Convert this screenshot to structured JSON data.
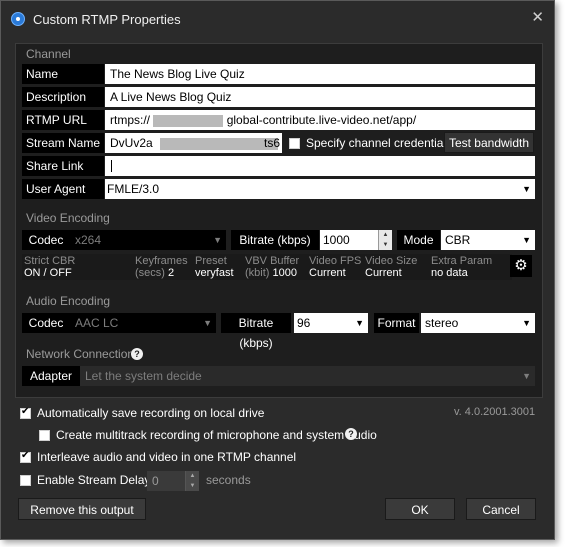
{
  "window": {
    "title": "Custom RTMP Properties",
    "close_glyph": "✕"
  },
  "channel": {
    "section": "Channel",
    "name_label": "Name",
    "name_value": "The News Blog Live Quiz",
    "desc_label": "Description",
    "desc_value": "A Live News Blog Quiz",
    "url_label": "RTMP URL",
    "url_prefix": "rtmps://",
    "url_suffix": "global-contribute.live-video.net/app/",
    "stream_label": "Stream Name",
    "stream_prefix": "DvUv2a",
    "stream_suffix": "ts6",
    "cred_label": "Specify channel credentials",
    "test_button": "Test bandwidth",
    "share_label": "Share Link",
    "share_value": "",
    "agent_label": "User Agent",
    "agent_value": "FMLE/3.0"
  },
  "video": {
    "section": "Video Encoding",
    "codec_label": "Codec",
    "codec_value": "x264",
    "bitrate_label": "Bitrate (kbps)",
    "bitrate_value": "1000",
    "mode_label": "Mode",
    "mode_value": "CBR",
    "stats": [
      {
        "k": "Strict CBR",
        "v": "ON / OFF"
      },
      {
        "k": "Keyframes",
        "k2": "(secs)",
        "v": "2"
      },
      {
        "k": "Preset",
        "v": "veryfast"
      },
      {
        "k": "VBV Buffer",
        "k2": "(kbit)",
        "v": "1000"
      },
      {
        "k": "Video FPS",
        "v": "Current"
      },
      {
        "k": "Video Size",
        "v": "Current"
      },
      {
        "k": "Extra Param",
        "v": "no data"
      }
    ]
  },
  "audio": {
    "section": "Audio Encoding",
    "codec_label": "Codec",
    "codec_value": "AAC LC",
    "bitrate_label": "Bitrate (kbps)",
    "bitrate_value": "96",
    "format_label": "Format",
    "format_value": "stereo"
  },
  "network": {
    "section": "Network Connection",
    "adapter_label": "Adapter",
    "adapter_value": "Let the system decide"
  },
  "options": {
    "auto_save": "Automatically save recording on local drive",
    "multitrack": "Create multitrack recording of microphone and system audio",
    "interleave": "Interleave audio and video in one RTMP channel",
    "delay": "Enable Stream Delay",
    "delay_value": "0",
    "delay_unit": "seconds",
    "version": "v. 4.0.2001.3001"
  },
  "footer": {
    "remove": "Remove this output",
    "ok": "OK",
    "cancel": "Cancel"
  }
}
